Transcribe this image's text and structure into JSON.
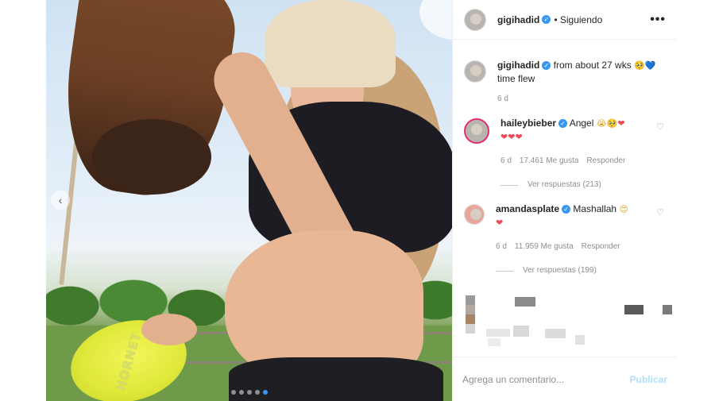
{
  "post": {
    "frisbee_text": "HORNET",
    "nav_prev_icon": "chevron-left-icon",
    "carousel": {
      "total": 5,
      "active": 5
    }
  },
  "header": {
    "username": "gigihadid",
    "follow_status": "• Siguiendo",
    "more_icon": "more-icon",
    "more_glyph": "•••"
  },
  "caption": {
    "username": "gigihadid",
    "text": "from about 27 wks",
    "text2": "time flew",
    "emoji_1": "🥺",
    "emoji_2": "💙",
    "time": "6 d"
  },
  "comments": [
    {
      "username": "haileybieber",
      "text": "Angel",
      "emojis": [
        "😭",
        "🥺",
        "❤",
        "❤",
        "❤",
        "❤"
      ],
      "time": "6 d",
      "likes": "17.461 Me gusta",
      "reply": "Responder",
      "view_replies": "Ver respuestas (213)"
    },
    {
      "username": "amandasplate",
      "text": "Mashallah",
      "emojis": [
        "😍",
        "❤"
      ],
      "time": "6 d",
      "likes": "11.959 Me gusta",
      "reply": "Responder",
      "view_replies": "Ver respuestas (199)"
    }
  ],
  "add_comment": {
    "placeholder": "Agrega un comentario...",
    "publish_label": "Publicar"
  },
  "colors": {
    "verified": "#3897f0",
    "publish_disabled": "#b2dffc",
    "active_dot": "#3897f0"
  }
}
